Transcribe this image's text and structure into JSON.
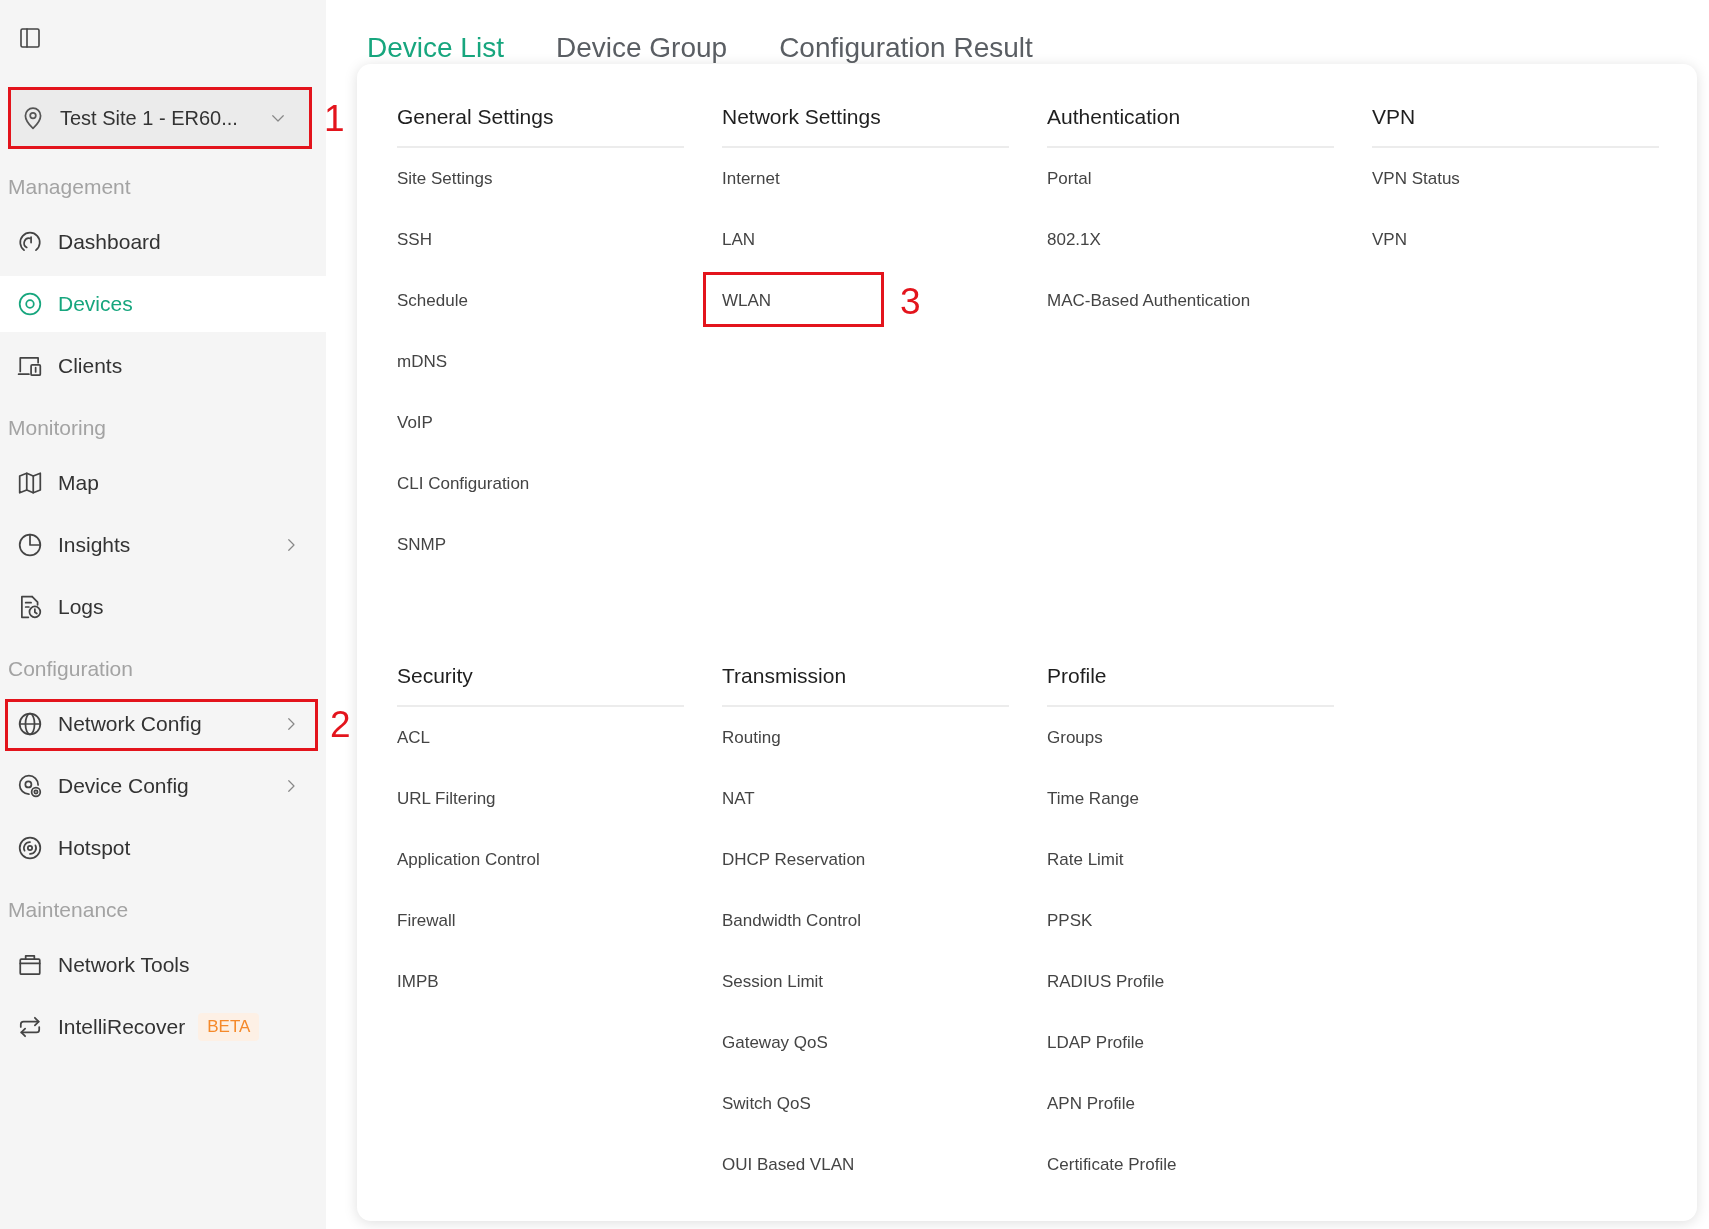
{
  "sidebar": {
    "site_selector": {
      "label": "Test Site 1 - ER60...",
      "callout": "1"
    },
    "sections": [
      {
        "title": "Management",
        "items": [
          {
            "label": "Dashboard",
            "selected": false,
            "has_submenu": false
          },
          {
            "label": "Devices",
            "selected": true,
            "has_submenu": false
          },
          {
            "label": "Clients",
            "selected": false,
            "has_submenu": false
          }
        ]
      },
      {
        "title": "Monitoring",
        "items": [
          {
            "label": "Map",
            "selected": false,
            "has_submenu": false
          },
          {
            "label": "Insights",
            "selected": false,
            "has_submenu": true
          },
          {
            "label": "Logs",
            "selected": false,
            "has_submenu": false
          }
        ]
      },
      {
        "title": "Configuration",
        "items": [
          {
            "label": "Network Config",
            "selected": false,
            "has_submenu": true,
            "callout": "2"
          },
          {
            "label": "Device Config",
            "selected": false,
            "has_submenu": true
          },
          {
            "label": "Hotspot",
            "selected": false,
            "has_submenu": false
          }
        ]
      },
      {
        "title": "Maintenance",
        "items": [
          {
            "label": "Network Tools",
            "selected": false,
            "has_submenu": false
          },
          {
            "label": "IntelliRecover",
            "selected": false,
            "has_submenu": false,
            "badge": "BETA"
          }
        ]
      }
    ]
  },
  "tabs": [
    {
      "label": "Device List",
      "selected": true
    },
    {
      "label": "Device Group",
      "selected": false
    },
    {
      "label": "Configuration Result",
      "selected": false
    }
  ],
  "menu": {
    "groups": [
      {
        "title": "General Settings",
        "items": [
          {
            "label": "Site Settings"
          },
          {
            "label": "SSH"
          },
          {
            "label": "Schedule"
          },
          {
            "label": "mDNS"
          },
          {
            "label": "VoIP"
          },
          {
            "label": "CLI Configuration"
          },
          {
            "label": "SNMP"
          }
        ]
      },
      {
        "title": "Network Settings",
        "items": [
          {
            "label": "Internet"
          },
          {
            "label": "LAN"
          },
          {
            "label": "WLAN",
            "callout": "3"
          }
        ]
      },
      {
        "title": "Authentication",
        "items": [
          {
            "label": "Portal"
          },
          {
            "label": "802.1X"
          },
          {
            "label": "MAC-Based Authentication"
          }
        ]
      },
      {
        "title": "VPN",
        "items": [
          {
            "label": "VPN Status"
          },
          {
            "label": "VPN"
          }
        ]
      },
      {
        "title": "Security",
        "items": [
          {
            "label": "ACL"
          },
          {
            "label": "URL Filtering"
          },
          {
            "label": "Application Control"
          },
          {
            "label": "Firewall"
          },
          {
            "label": "IMPB"
          }
        ]
      },
      {
        "title": "Transmission",
        "items": [
          {
            "label": "Routing"
          },
          {
            "label": "NAT"
          },
          {
            "label": "DHCP Reservation"
          },
          {
            "label": "Bandwidth Control"
          },
          {
            "label": "Session Limit"
          },
          {
            "label": "Gateway QoS"
          },
          {
            "label": "Switch QoS"
          },
          {
            "label": "OUI Based VLAN"
          }
        ]
      },
      {
        "title": "Profile",
        "items": [
          {
            "label": "Groups"
          },
          {
            "label": "Time Range"
          },
          {
            "label": "Rate Limit"
          },
          {
            "label": "PPSK"
          },
          {
            "label": "RADIUS Profile"
          },
          {
            "label": "LDAP Profile"
          },
          {
            "label": "APN Profile"
          },
          {
            "label": "Certificate Profile"
          }
        ]
      }
    ]
  }
}
